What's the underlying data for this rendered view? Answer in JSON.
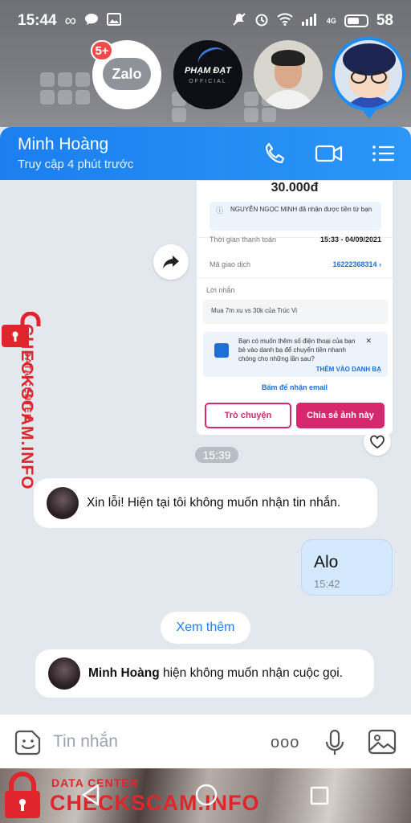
{
  "status_bar": {
    "time": "15:44",
    "battery": "58",
    "network": "4G"
  },
  "chat_heads": {
    "zalo_label": "Zalo",
    "zalo_badge": "5+",
    "pham_dat_line1": "PHẠM ĐẠT",
    "pham_dat_line2": "OFFICIAL"
  },
  "header": {
    "contact_name": "Minh Hoàng",
    "last_seen": "Truy cập 4 phút trước"
  },
  "shared_screenshot": {
    "amount": "30.000đ",
    "received_note": "NGUYỄN NGỌC MINH đã nhận được tiền từ bạn",
    "payment_time_label": "Thời gian thanh toán",
    "payment_time_value": "15:33 - 04/09/2021",
    "transaction_label": "Mã giao dịch",
    "transaction_value": "16222368314 ›",
    "message_label": "Lời nhắn",
    "message_value": "Mua 7m xu vs 30k của Trúc Vi",
    "promo_text": "Bạn có muốn thêm số điện thoại của bạn bè vào danh bạ để chuyển tiền nhanh chóng cho những lần sau?",
    "promo_close": "✕",
    "promo_add": "THÊM VÀO DANH BẠ",
    "email_link": "Bấm để nhận email",
    "chat_button": "Trò chuyện",
    "share_button": "Chia sẻ ảnh này"
  },
  "messages": {
    "time_separator": "15:39",
    "incoming_1": "Xin lỗi! Hiện tại tôi không muốn nhận tin nhắn.",
    "outgoing_1": {
      "text": "Alo",
      "time": "15:42"
    },
    "see_more": "Xem thêm",
    "incoming_2_name": "Minh Hoàng",
    "incoming_2_text": " hiện không muốn nhận cuộc gọi."
  },
  "input": {
    "placeholder": "Tin nhắn",
    "more": "ooo"
  },
  "watermark": {
    "line1": "DATA CENTER",
    "line2": "CHECKSCAM.INFO"
  },
  "colors": {
    "accent": "#1e8ef5",
    "pink": "#d6286f",
    "watermark": "#e0262c"
  },
  "icons": [
    "phone-icon",
    "video-icon",
    "menu-icon",
    "share-arrow-icon",
    "heart-icon",
    "sticker-icon",
    "more-icon",
    "microphone-icon",
    "image-icon",
    "back-icon",
    "home-icon",
    "recents-icon",
    "lock-icon"
  ]
}
